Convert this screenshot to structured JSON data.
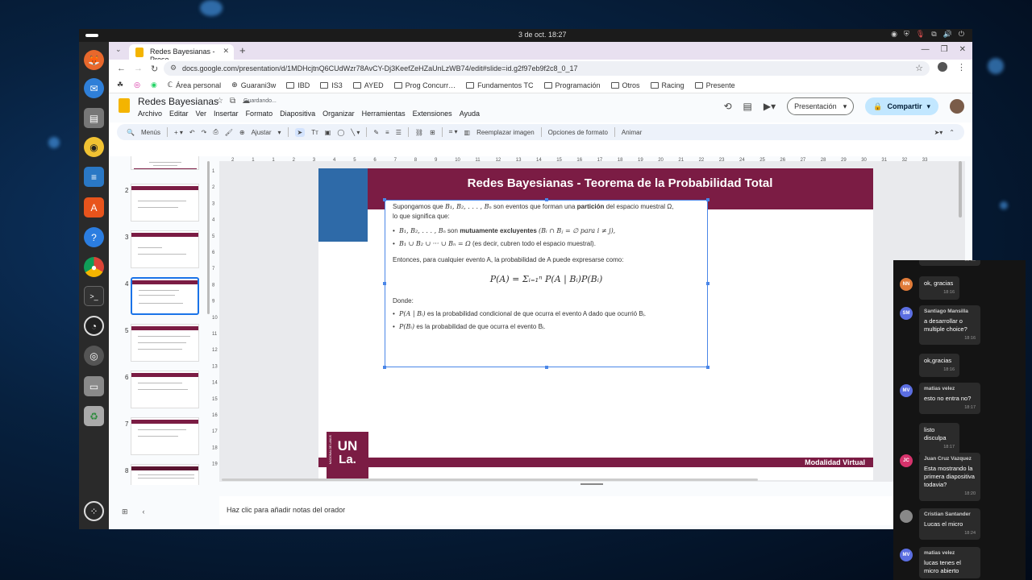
{
  "system": {
    "clock": "3 de oct. 18:27"
  },
  "browser": {
    "tab_title": "Redes Bayesianas - Prese",
    "url": "docs.google.com/presentation/d/1MDHcjtnQ6CUdWzr78AvCY-Dj3KeefZeHZaUnLzWB74/edit#slide=id.g2f97eb9f2c8_0_17",
    "bookmarks": [
      "Área personal",
      "Guarani3w",
      "IBD",
      "IS3",
      "AYED",
      "Prog Concurr…",
      "Fundamentos TC",
      "Programación",
      "Otros",
      "Racing",
      "Presente"
    ]
  },
  "app": {
    "doc_title": "Redes Bayesianas",
    "save_status": "Guardando...",
    "menu": [
      "Archivo",
      "Editar",
      "Ver",
      "Insertar",
      "Formato",
      "Diapositiva",
      "Organizar",
      "Herramientas",
      "Extensiones",
      "Ayuda"
    ],
    "present_label": "Presentación",
    "share_label": "Compartir",
    "toolbar": {
      "menus_label": "Menús",
      "zoom_label": "Ajustar",
      "replace_image": "Reemplazar imagen",
      "format_options": "Opciones de formato",
      "animate": "Animar"
    }
  },
  "filmstrip": {
    "numbers": [
      "2",
      "3",
      "4",
      "5",
      "6",
      "7",
      "8"
    ],
    "selected": "4"
  },
  "ruler": {
    "h_ticks": [
      "2",
      "1",
      "1",
      "2",
      "3",
      "4",
      "5",
      "6",
      "7",
      "8",
      "9",
      "10",
      "11",
      "12",
      "13",
      "14",
      "15",
      "16",
      "17",
      "18",
      "19",
      "20",
      "21",
      "22",
      "23",
      "24",
      "25",
      "26",
      "27",
      "28",
      "29",
      "30",
      "31",
      "32",
      "33"
    ],
    "v_ticks": [
      "1",
      "2",
      "3",
      "4",
      "5",
      "6",
      "7",
      "8",
      "9",
      "10",
      "11",
      "12",
      "13",
      "14",
      "15",
      "16",
      "17",
      "18",
      "19"
    ]
  },
  "slide": {
    "title": "Redes Bayesianas - Teorema de la Probabilidad Total",
    "intro_1": "Supongamos que",
    "intro_events": "B₁, B₂, . . . , Bₙ",
    "intro_2": "son eventos que forman una",
    "intro_bold": "partición",
    "intro_3": "del espacio muestral Ω,",
    "intro_4": "lo que significa que:",
    "b1_math": "B₁, B₂, . . . , Bₙ",
    "b1_text": "son",
    "b1_bold": "mutuamente excluyentes",
    "b1_tail": "(Bᵢ ∩ Bⱼ = ∅ para i ≠ j),",
    "b2_math": "B₁ ∪ B₂ ∪ ··· ∪ Bₙ = Ω",
    "b2_text": "(es decir, cubren todo el espacio muestral).",
    "then_text": "Entonces, para cualquier evento A, la probabilidad de A puede expresarse como:",
    "formula": "P(A) = Σᵢ₌₁ⁿ P(A | Bᵢ)P(Bᵢ)",
    "donde": "Donde:",
    "d1_math": "P(A | Bᵢ)",
    "d1_text": "es la probabilidad condicional de que ocurra el evento A dado que ocurrió Bᵢ.",
    "d2_math": "P(Bᵢ)",
    "d2_text": "es la probabilidad de que ocurra el evento Bᵢ.",
    "footer": "Modalidad Virtual",
    "logo_small": "NACIONAL DE LANÚS",
    "logo_un": "UN",
    "logo_la": "La."
  },
  "notes_placeholder": "Haz clic para añadir notas del orador",
  "chat": [
    {
      "initials": "",
      "name": "",
      "text": "",
      "time": "18:15",
      "color": "#999999"
    },
    {
      "initials": "NN",
      "name": "",
      "text": "ok, gracias",
      "time": "18:16",
      "color": "#e07b39"
    },
    {
      "initials": "SM",
      "name": "Santiago Mansilla",
      "text": "a desarrollar o multiple choice?",
      "time": "18:16",
      "color": "#5b6ee1"
    },
    {
      "initials": "",
      "name": "",
      "text": "ok,gracias",
      "time": "18:16",
      "color": "#999999"
    },
    {
      "initials": "MV",
      "name": "matias velez",
      "text": "esto no entra no?",
      "time": "18:17",
      "color": "#5b6ee1"
    },
    {
      "initials": "",
      "name": "",
      "text": "listo disculpa",
      "time": "18:17",
      "color": "#999999"
    },
    {
      "initials": "JC",
      "name": "Juan Cruz Vazquez",
      "text": "Esta mostrando la primera diapositiva todavia?",
      "time": "18:20",
      "color": "#d6336c"
    },
    {
      "initials": "",
      "name": "Cristian Santander",
      "text": "Lucas el micro",
      "time": "18:24",
      "color": "#888888"
    },
    {
      "initials": "MV",
      "name": "matias velez",
      "text": "lucas tenes el micro abierto",
      "time": "",
      "color": "#5b6ee1"
    }
  ]
}
